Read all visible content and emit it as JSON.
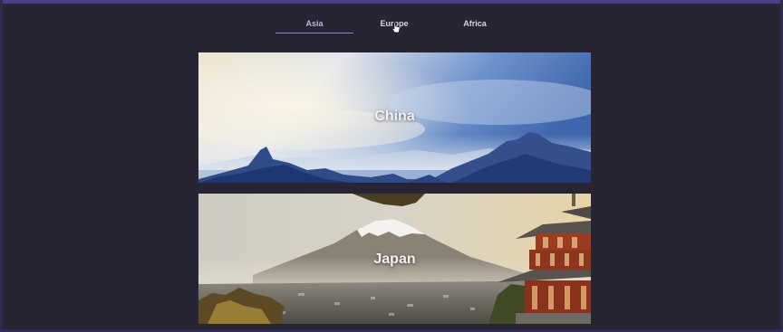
{
  "tabs": [
    {
      "label": "Asia",
      "active": true
    },
    {
      "label": "Europe",
      "active": false
    },
    {
      "label": "Africa",
      "active": false
    }
  ],
  "cards": [
    {
      "title": "China"
    },
    {
      "title": "Japan"
    }
  ],
  "colors": {
    "background": "#272533",
    "accent": "#8d86c9",
    "tab_text": "#d7d6e2"
  }
}
